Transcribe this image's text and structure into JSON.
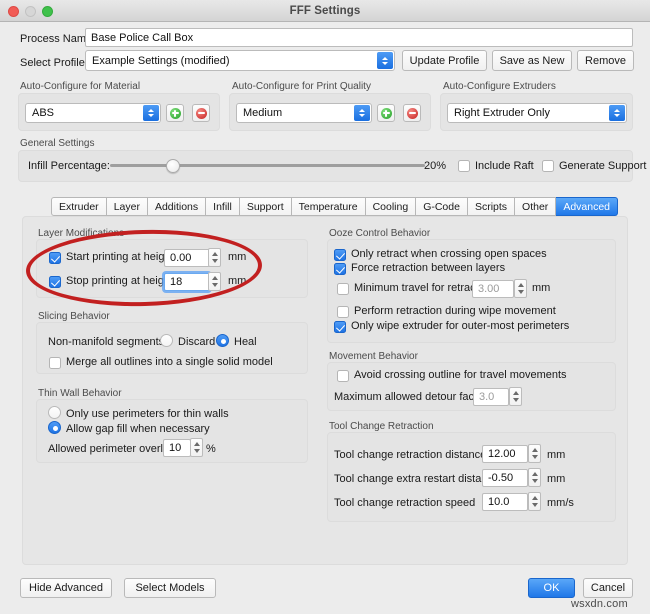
{
  "window": {
    "title": "FFF Settings",
    "traffic_lights": [
      "close-red",
      "minimize-gray",
      "zoom-green"
    ]
  },
  "top_form": {
    "process_name_label": "Process Name:",
    "process_name_value": "Base Police Call Box",
    "select_profile_label": "Select Profile:",
    "select_profile_value": "Example Settings (modified)",
    "update_profile_button": "Update Profile",
    "save_as_new_button": "Save as New",
    "remove_button": "Remove"
  },
  "auto_configure": {
    "material": {
      "title": "Auto-Configure for Material",
      "value": "ABS",
      "add_icon": "plus-circle-icon",
      "remove_icon": "minus-circle-icon"
    },
    "quality": {
      "title": "Auto-Configure for Print Quality",
      "value": "Medium",
      "add_icon": "plus-circle-icon",
      "remove_icon": "minus-circle-icon"
    },
    "extruders": {
      "title": "Auto-Configure Extruders",
      "value": "Right Extruder Only"
    }
  },
  "general_settings": {
    "title": "General Settings",
    "infill_label": "Infill Percentage:",
    "infill_value": "20%",
    "infill_percent": 20,
    "include_raft_label": "Include Raft",
    "include_raft_checked": false,
    "generate_support_label": "Generate Support",
    "generate_support_checked": false
  },
  "tabs": [
    {
      "label": "Extruder",
      "active": false
    },
    {
      "label": "Layer",
      "active": false
    },
    {
      "label": "Additions",
      "active": false
    },
    {
      "label": "Infill",
      "active": false
    },
    {
      "label": "Support",
      "active": false
    },
    {
      "label": "Temperature",
      "active": false
    },
    {
      "label": "Cooling",
      "active": false
    },
    {
      "label": "G-Code",
      "active": false
    },
    {
      "label": "Scripts",
      "active": false
    },
    {
      "label": "Other",
      "active": false
    },
    {
      "label": "Advanced",
      "active": true
    }
  ],
  "advanced": {
    "layer_modifications": {
      "title": "Layer Modifications",
      "start_label": "Start printing at height",
      "start_checked": true,
      "start_value": "0.00",
      "start_unit": "mm",
      "stop_label": "Stop printing at height",
      "stop_checked": true,
      "stop_value": "18",
      "stop_unit": "mm",
      "stop_focused": true
    },
    "slicing_behavior": {
      "title": "Slicing Behavior",
      "nonmanifold_label": "Non-manifold segments:",
      "discard_label": "Discard",
      "discard_selected": false,
      "heal_label": "Heal",
      "heal_selected": true,
      "merge_label": "Merge all outlines into a single solid model",
      "merge_checked": false
    },
    "thin_wall_behavior": {
      "title": "Thin Wall Behavior",
      "perimeters_only_label": "Only use perimeters for thin walls",
      "perimeters_only_selected": false,
      "gap_fill_label": "Allow gap fill when necessary",
      "gap_fill_selected": true,
      "overlap_label": "Allowed perimeter overlap",
      "overlap_value": "10",
      "overlap_unit": "%"
    },
    "ooze_control": {
      "title": "Ooze Control Behavior",
      "only_retract_label": "Only retract when crossing open spaces",
      "only_retract_checked": true,
      "force_retraction_label": "Force retraction between layers",
      "force_retraction_checked": true,
      "min_travel_label": "Minimum travel for retraction",
      "min_travel_checked": false,
      "min_travel_value": "3.00",
      "min_travel_unit": "mm",
      "min_travel_disabled": true,
      "wipe_retraction_label": "Perform retraction during wipe movement",
      "wipe_retraction_checked": false,
      "outer_wipe_label": "Only wipe extruder for outer-most perimeters",
      "outer_wipe_checked": true
    },
    "movement_behavior": {
      "title": "Movement Behavior",
      "avoid_crossing_label": "Avoid crossing outline for travel movements",
      "avoid_crossing_checked": false,
      "detour_label": "Maximum allowed detour factor",
      "detour_value": "3.0",
      "detour_disabled": true
    },
    "tool_change_retraction": {
      "title": "Tool Change Retraction",
      "distance_label": "Tool change retraction distance",
      "distance_value": "12.00",
      "distance_unit": "mm",
      "restart_label": "Tool change extra restart distance",
      "restart_value": "-0.50",
      "restart_unit": "mm",
      "speed_label": "Tool change retraction speed",
      "speed_value": "10.0",
      "speed_unit": "mm/s"
    }
  },
  "footer": {
    "hide_advanced_button": "Hide Advanced",
    "select_models_button": "Select Models",
    "ok_button": "OK",
    "cancel_button": "Cancel"
  },
  "watermark": "wsxdn.com",
  "colors": {
    "accent_blue": "#2078e9",
    "annotation_red": "#c22020",
    "panel_gray": "#ececec",
    "group_gray": "#e4e4e4"
  }
}
